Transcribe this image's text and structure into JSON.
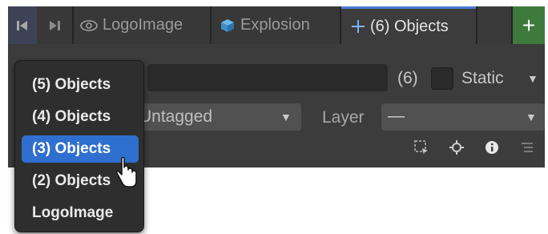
{
  "tabs": [
    {
      "label": "LogoImage",
      "icon": "eye-icon"
    },
    {
      "label": "Explosion",
      "icon": "cube-icon"
    },
    {
      "label": "(6) Objects",
      "icon": "move-cross-icon",
      "active": true
    }
  ],
  "tab_nav": {
    "prev_icon": "skip-back-icon",
    "next_icon": "skip-forward-icon",
    "add_icon": "plus-icon"
  },
  "inspector": {
    "object_count": "(6)",
    "static_label": "Static",
    "tag_value": "Untagged",
    "layer_label": "Layer",
    "layer_value": "—",
    "tool_icons": [
      "select-region-icon",
      "pivot-icon",
      "info-icon",
      "list-icon"
    ]
  },
  "menu": {
    "items": [
      "(5) Objects",
      "(4) Objects",
      "(3) Objects",
      "(2) Objects",
      "LogoImage"
    ],
    "selected_index": 2
  },
  "colors": {
    "menu_highlight": "#2f6fcf",
    "active_tab_accent": "#4c7bd3",
    "add_button": "#3f7a3d",
    "panel_bg": "#3c3c3c"
  }
}
